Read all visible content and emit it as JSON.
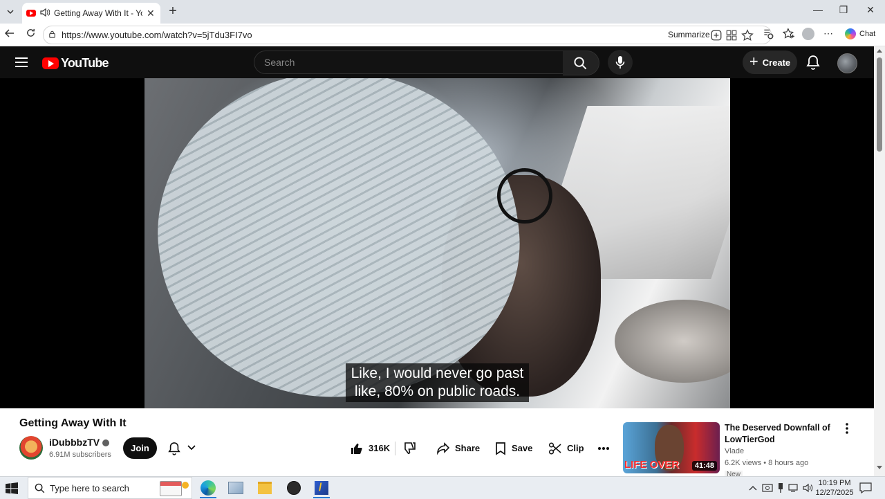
{
  "browser": {
    "tab_title": "Getting Away With It - YouTube",
    "url": "https://www.youtube.com/watch?v=5jTdu3FI7vo",
    "summarize_label": "Summarize",
    "chat_label": "Chat"
  },
  "youtube": {
    "logo_text": "YouTube",
    "search_placeholder": "Search",
    "create_label": "Create"
  },
  "video": {
    "caption_line1": "Like, I would never go past",
    "caption_line2": "like, 80% on public roads.",
    "title": "Getting Away With It",
    "channel": "iDubbbzTV",
    "subscribers": "6.91M subscribers",
    "join_label": "Join",
    "likes": "316K",
    "share_label": "Share",
    "save_label": "Save",
    "clip_label": "Clip"
  },
  "recommendation": {
    "title": "The Deserved Downfall of LowTierGod",
    "channel": "Vlade",
    "meta": "6.2K views • 8 hours ago",
    "duration": "41:48",
    "thumb_text": "LIFE OVER",
    "badge": "New"
  },
  "taskbar": {
    "search_placeholder": "Type here to search",
    "time": "10:19 PM",
    "date": "12/27/2025"
  },
  "colors": {
    "youtube_red": "#ff0000",
    "dark_bg": "#0f0f0f",
    "accent_blue": "#2b7ad3"
  }
}
